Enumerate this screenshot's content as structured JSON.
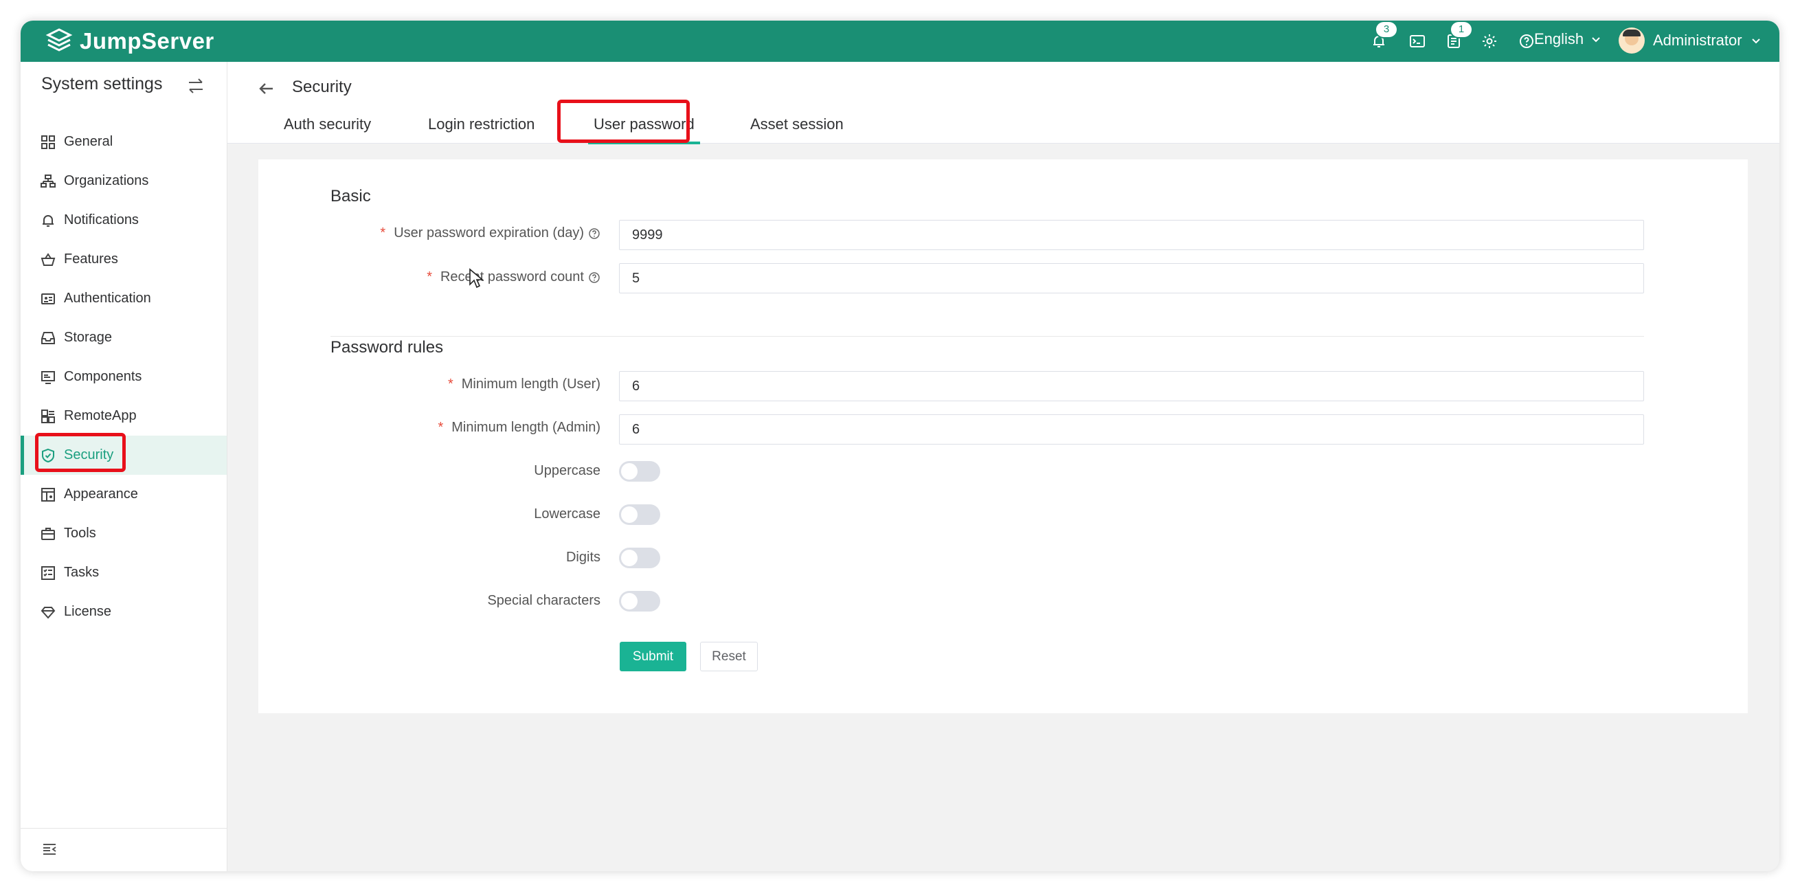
{
  "brand": {
    "name": "JumpServer"
  },
  "topbar": {
    "notifications_count": "3",
    "tickets_count": "1",
    "language": "English",
    "user_name": "Administrator"
  },
  "sidebar": {
    "title": "System settings",
    "items": [
      {
        "label": "General",
        "icon": "grid-icon"
      },
      {
        "label": "Organizations",
        "icon": "org-chart-icon"
      },
      {
        "label": "Notifications",
        "icon": "bell-icon"
      },
      {
        "label": "Features",
        "icon": "basket-icon"
      },
      {
        "label": "Authentication",
        "icon": "id-card-icon"
      },
      {
        "label": "Storage",
        "icon": "inbox-icon"
      },
      {
        "label": "Components",
        "icon": "monitor-icon"
      },
      {
        "label": "RemoteApp",
        "icon": "apps-icon"
      },
      {
        "label": "Security",
        "icon": "shield-check-icon",
        "active": true
      },
      {
        "label": "Appearance",
        "icon": "layout-icon"
      },
      {
        "label": "Tools",
        "icon": "toolbox-icon"
      },
      {
        "label": "Tasks",
        "icon": "task-list-icon"
      },
      {
        "label": "License",
        "icon": "diamond-icon"
      }
    ]
  },
  "header": {
    "title": "Security",
    "tabs": [
      {
        "label": "Auth security"
      },
      {
        "label": "Login restriction"
      },
      {
        "label": "User password",
        "active": true
      },
      {
        "label": "Asset session"
      }
    ]
  },
  "form": {
    "basic": {
      "title": "Basic",
      "expiration_label": "User password expiration (day)",
      "expiration_value": "9999",
      "recent_count_label": "Recent password count",
      "recent_count_value": "5"
    },
    "rules": {
      "title": "Password rules",
      "min_user_label": "Minimum length (User)",
      "min_user_value": "6",
      "min_admin_label": "Minimum length (Admin)",
      "min_admin_value": "6",
      "uppercase_label": "Uppercase",
      "uppercase_on": false,
      "lowercase_label": "Lowercase",
      "lowercase_on": false,
      "digits_label": "Digits",
      "digits_on": false,
      "special_label": "Special characters",
      "special_on": false
    },
    "submit_label": "Submit",
    "reset_label": "Reset"
  },
  "colors": {
    "brand": "#1a8f74",
    "accent": "#1ab394",
    "required": "#e74c3c",
    "highlight": "#e8101a"
  }
}
